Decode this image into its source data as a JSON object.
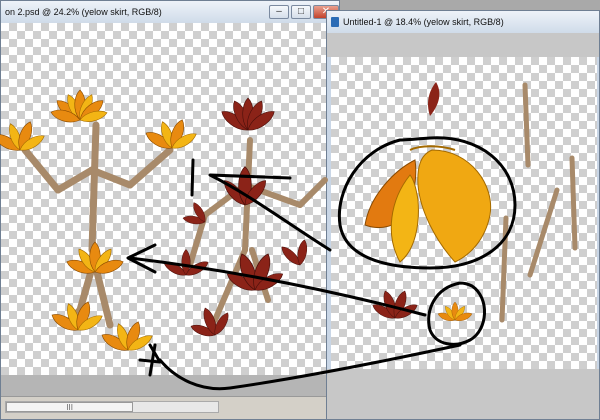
{
  "window_left": {
    "title": "on 2.psd @ 24.2% (yelow skirt, RGB/8)",
    "minimize_label": "–",
    "maximize_label": "□",
    "close_label": "✕",
    "scroll_thumb_label": "III"
  },
  "window_right": {
    "title": "Untitled-1 @ 18.4% (yelow skirt, RGB/8)"
  },
  "colors": {
    "leaf_orange": "#e88a10",
    "leaf_yellow": "#f3b515",
    "leaf_red": "#8b2318",
    "stick": "#a88a6a",
    "ink": "#000000"
  }
}
